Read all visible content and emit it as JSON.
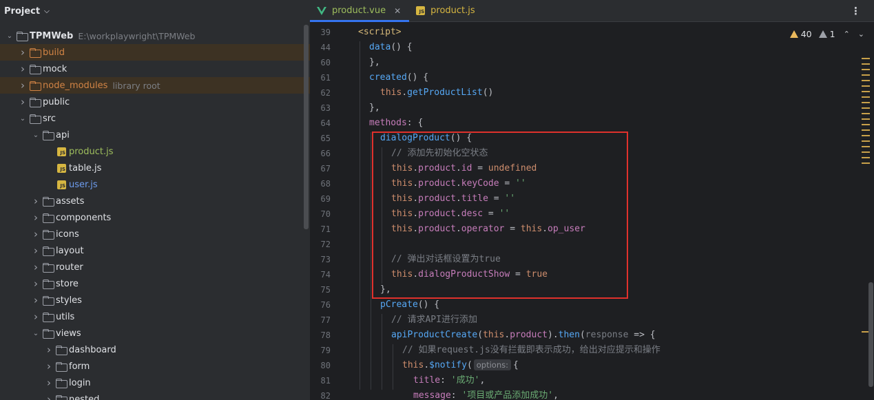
{
  "project_panel": {
    "title": "Project",
    "tree": [
      {
        "label": "TPMWeb",
        "extra": "E:\\workplaywright\\TPMWeb",
        "depth": 0,
        "expanded": true,
        "icon": "folder-icon"
      },
      {
        "label": "build",
        "depth": 1,
        "expanded": false,
        "icon": "folder-icon",
        "excluded": true
      },
      {
        "label": "mock",
        "depth": 1,
        "expanded": false,
        "icon": "folder-icon"
      },
      {
        "label": "node_modules",
        "extra": "library root",
        "depth": 1,
        "expanded": false,
        "icon": "folder-icon",
        "excluded": true
      },
      {
        "label": "public",
        "depth": 1,
        "expanded": false,
        "icon": "folder-icon"
      },
      {
        "label": "src",
        "depth": 1,
        "expanded": true,
        "icon": "folder-icon"
      },
      {
        "label": "api",
        "depth": 2,
        "expanded": true,
        "icon": "folder-icon"
      },
      {
        "label": "product.js",
        "depth": 3,
        "icon": "js-file-icon",
        "color": "green"
      },
      {
        "label": "table.js",
        "depth": 3,
        "icon": "js-file-icon"
      },
      {
        "label": "user.js",
        "depth": 3,
        "icon": "js-file-icon",
        "color": "blue"
      },
      {
        "label": "assets",
        "depth": 2,
        "expanded": false,
        "icon": "folder-icon"
      },
      {
        "label": "components",
        "depth": 2,
        "expanded": false,
        "icon": "folder-icon"
      },
      {
        "label": "icons",
        "depth": 2,
        "expanded": false,
        "icon": "folder-icon"
      },
      {
        "label": "layout",
        "depth": 2,
        "expanded": false,
        "icon": "folder-icon"
      },
      {
        "label": "router",
        "depth": 2,
        "expanded": false,
        "icon": "folder-icon"
      },
      {
        "label": "store",
        "depth": 2,
        "expanded": false,
        "icon": "folder-icon"
      },
      {
        "label": "styles",
        "depth": 2,
        "expanded": false,
        "icon": "folder-icon"
      },
      {
        "label": "utils",
        "depth": 2,
        "expanded": false,
        "icon": "folder-icon"
      },
      {
        "label": "views",
        "depth": 2,
        "expanded": true,
        "icon": "folder-icon"
      },
      {
        "label": "dashboard",
        "depth": 3,
        "expanded": false,
        "icon": "folder-icon"
      },
      {
        "label": "form",
        "depth": 3,
        "expanded": false,
        "icon": "folder-icon"
      },
      {
        "label": "login",
        "depth": 3,
        "expanded": false,
        "icon": "folder-icon"
      },
      {
        "label": "nested",
        "depth": 3,
        "expanded": false,
        "icon": "folder-icon"
      }
    ]
  },
  "tabs": [
    {
      "label": "product.vue",
      "active": true,
      "icon": "vue-file-icon",
      "close": "✕"
    },
    {
      "label": "product.js",
      "active": false,
      "icon": "js-file-icon"
    }
  ],
  "tab_menu": "⋮",
  "inspection": {
    "warnings": "40",
    "weak_warnings": "1"
  },
  "colors": {
    "accent": "#3574f0",
    "highlight_box": "#e0312c",
    "warning": "#e9b85c"
  },
  "code_lines": [
    {
      "n": "39",
      "indent": 0,
      "tokens": [
        [
          "tag",
          "<script>"
        ]
      ]
    },
    {
      "n": "44",
      "indent": 1,
      "tokens": [
        [
          "fn",
          "data"
        ],
        [
          "plain",
          "() {"
        ]
      ]
    },
    {
      "n": "60",
      "indent": 1,
      "tokens": [
        [
          "plain",
          "},"
        ]
      ]
    },
    {
      "n": "61",
      "indent": 1,
      "tokens": [
        [
          "fn",
          "created"
        ],
        [
          "plain",
          "() {"
        ]
      ]
    },
    {
      "n": "62",
      "indent": 2,
      "tokens": [
        [
          "this",
          "this"
        ],
        [
          "plain",
          "."
        ],
        [
          "fn",
          "getProductList"
        ],
        [
          "plain",
          "()"
        ]
      ]
    },
    {
      "n": "63",
      "indent": 1,
      "tokens": [
        [
          "plain",
          "},"
        ]
      ]
    },
    {
      "n": "64",
      "indent": 1,
      "tokens": [
        [
          "prop",
          "methods"
        ],
        [
          "plain",
          ": {"
        ]
      ]
    },
    {
      "n": "65",
      "indent": 2,
      "tokens": [
        [
          "fn",
          "dialogProduct"
        ],
        [
          "plain",
          "() {"
        ]
      ]
    },
    {
      "n": "66",
      "indent": 3,
      "tokens": [
        [
          "cmt",
          "// 添加先初始化空状态"
        ]
      ]
    },
    {
      "n": "67",
      "indent": 3,
      "tokens": [
        [
          "this",
          "this"
        ],
        [
          "plain",
          "."
        ],
        [
          "prop",
          "product"
        ],
        [
          "plain",
          "."
        ],
        [
          "prop",
          "id"
        ],
        [
          "plain",
          " = "
        ],
        [
          "kw",
          "undefined"
        ]
      ]
    },
    {
      "n": "68",
      "indent": 3,
      "tokens": [
        [
          "this",
          "this"
        ],
        [
          "plain",
          "."
        ],
        [
          "prop",
          "product"
        ],
        [
          "plain",
          "."
        ],
        [
          "prop",
          "keyCode"
        ],
        [
          "plain",
          " = "
        ],
        [
          "str",
          "''"
        ]
      ]
    },
    {
      "n": "69",
      "indent": 3,
      "tokens": [
        [
          "this",
          "this"
        ],
        [
          "plain",
          "."
        ],
        [
          "prop",
          "product"
        ],
        [
          "plain",
          "."
        ],
        [
          "prop",
          "title"
        ],
        [
          "plain",
          " = "
        ],
        [
          "str",
          "''"
        ]
      ]
    },
    {
      "n": "70",
      "indent": 3,
      "tokens": [
        [
          "this",
          "this"
        ],
        [
          "plain",
          "."
        ],
        [
          "prop",
          "product"
        ],
        [
          "plain",
          "."
        ],
        [
          "prop",
          "desc"
        ],
        [
          "plain",
          " = "
        ],
        [
          "str",
          "''"
        ]
      ]
    },
    {
      "n": "71",
      "indent": 3,
      "tokens": [
        [
          "this",
          "this"
        ],
        [
          "plain",
          "."
        ],
        [
          "prop",
          "product"
        ],
        [
          "plain",
          "."
        ],
        [
          "prop",
          "operator"
        ],
        [
          "plain",
          " = "
        ],
        [
          "this",
          "this"
        ],
        [
          "plain",
          "."
        ],
        [
          "prop",
          "op_user"
        ]
      ]
    },
    {
      "n": "72",
      "indent": 3,
      "tokens": []
    },
    {
      "n": "73",
      "indent": 3,
      "tokens": [
        [
          "cmt",
          "// 弹出对话框设置为true"
        ]
      ]
    },
    {
      "n": "74",
      "indent": 3,
      "tokens": [
        [
          "this",
          "this"
        ],
        [
          "plain",
          "."
        ],
        [
          "prop",
          "dialogProductShow"
        ],
        [
          "plain",
          " = "
        ],
        [
          "kw",
          "true"
        ]
      ]
    },
    {
      "n": "75",
      "indent": 2,
      "tokens": [
        [
          "plain",
          "},"
        ]
      ]
    },
    {
      "n": "76",
      "indent": 2,
      "tokens": [
        [
          "fn",
          "pCreate"
        ],
        [
          "plain",
          "() {"
        ]
      ]
    },
    {
      "n": "77",
      "indent": 3,
      "tokens": [
        [
          "cmt",
          "// 请求API进行添加"
        ]
      ]
    },
    {
      "n": "78",
      "indent": 3,
      "tokens": [
        [
          "fn",
          "apiProductCreate"
        ],
        [
          "plain",
          "("
        ],
        [
          "this",
          "this"
        ],
        [
          "plain",
          "."
        ],
        [
          "prop",
          "product"
        ],
        [
          "plain",
          ")."
        ],
        [
          "fn",
          "then"
        ],
        [
          "plain",
          "("
        ],
        [
          "param",
          "response"
        ],
        [
          "plain",
          " => {"
        ]
      ]
    },
    {
      "n": "79",
      "indent": 4,
      "tokens": [
        [
          "cmt",
          "// 如果request.js没有拦截即表示成功，给出对应提示和操作"
        ]
      ]
    },
    {
      "n": "80",
      "indent": 4,
      "tokens": [
        [
          "this",
          "this"
        ],
        [
          "plain",
          "."
        ],
        [
          "fn",
          "$notify"
        ],
        [
          "plain",
          "("
        ],
        [
          "hint",
          "options:"
        ],
        [
          "plain",
          "{"
        ]
      ]
    },
    {
      "n": "81",
      "indent": 5,
      "tokens": [
        [
          "prop",
          "title"
        ],
        [
          "plain",
          ": "
        ],
        [
          "str",
          "'成功'"
        ],
        [
          "plain",
          ","
        ]
      ]
    },
    {
      "n": "82",
      "indent": 5,
      "tokens": [
        [
          "prop",
          "message"
        ],
        [
          "plain",
          ": "
        ],
        [
          "str",
          "'项目或产品添加成功'"
        ],
        [
          "plain",
          ","
        ]
      ]
    }
  ]
}
